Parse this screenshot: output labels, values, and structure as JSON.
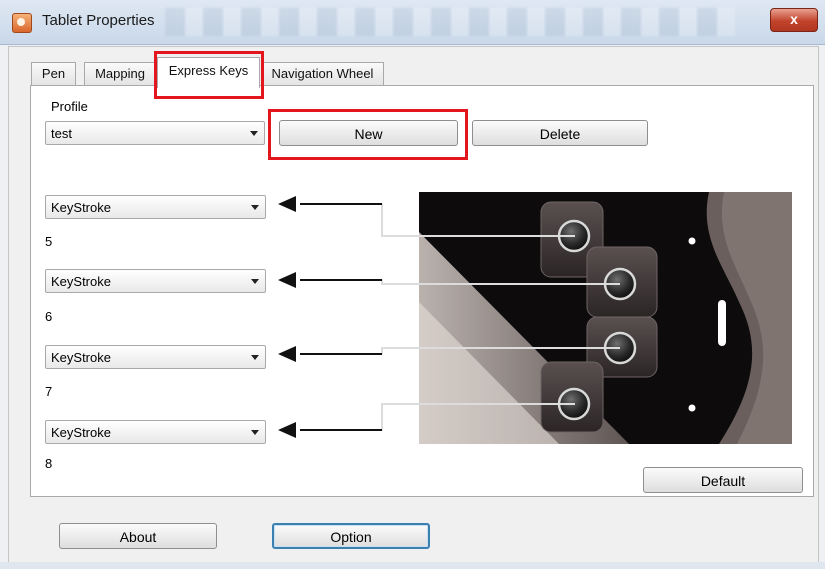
{
  "window": {
    "title": "Tablet Properties",
    "close_glyph": "x"
  },
  "tabs": [
    {
      "label": "Pen",
      "active": false
    },
    {
      "label": "Mapping",
      "active": false
    },
    {
      "label": "Express Keys",
      "active": true
    },
    {
      "label": "Navigation Wheel",
      "active": false
    }
  ],
  "profile": {
    "group_label": "Profile",
    "selected": "test",
    "new_label": "New",
    "delete_label": "Delete"
  },
  "express_keys": [
    {
      "action": "KeyStroke",
      "number": "5"
    },
    {
      "action": "KeyStroke",
      "number": "6"
    },
    {
      "action": "KeyStroke",
      "number": "7"
    },
    {
      "action": "KeyStroke",
      "number": "8"
    }
  ],
  "buttons": {
    "default_label": "Default",
    "about_label": "About",
    "option_label": "Option"
  },
  "colors": {
    "highlight": "#e3161e",
    "focus_border": "#3c7fb1"
  },
  "icons": {
    "app": "tablet-app-icon",
    "close": "close-icon",
    "dropdown": "chevron-down-icon"
  }
}
